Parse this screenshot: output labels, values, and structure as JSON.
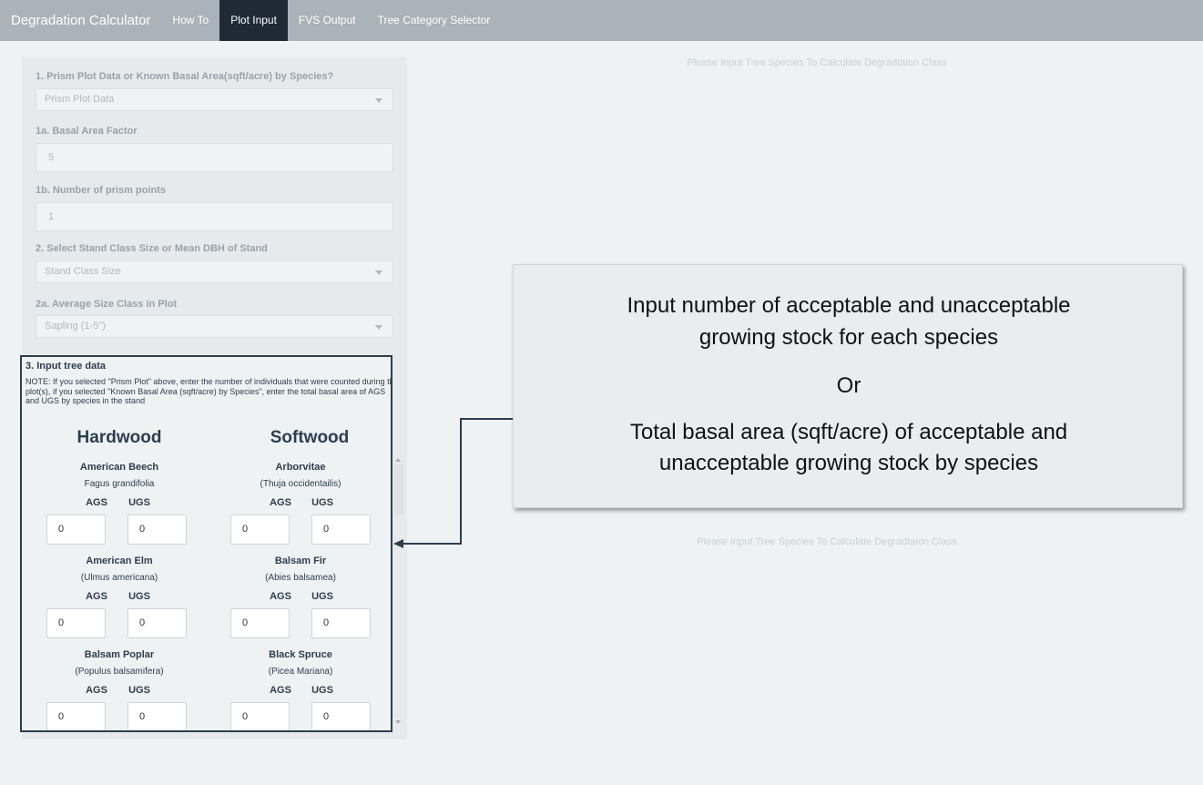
{
  "navbar": {
    "brand": "Degradation Calculator",
    "tabs": [
      {
        "label": "How To",
        "active": false
      },
      {
        "label": "Plot Input",
        "active": true
      },
      {
        "label": "FVS Output",
        "active": false
      },
      {
        "label": "Tree Category Selector",
        "active": false
      }
    ]
  },
  "form": {
    "q1_label": "1. Prism Plot Data or Known Basal Area(sqft/acre) by Species?",
    "q1_value": "Prism Plot Data",
    "q1a_label": "1a. Basal Area Factor",
    "q1a_value": "5",
    "q1b_label": "1b. Number of prism points",
    "q1b_value": "1",
    "q2_label": "2. Select Stand Class Size or Mean DBH of Stand",
    "q2_value": "Stand Class Size",
    "q2a_label": "2a. Average Size Class in Plot",
    "q2a_value": "Sapling (1-5\")"
  },
  "tree_data": {
    "title": "3. Input tree data",
    "note": "NOTE: If you selected \"Prism Plot\" above, enter the number of individuals that were counted during the plot(s), if you selected \"Known Basal Area (sqft/acre) by Species\", enter the total basal area of AGS and UGS by species in the stand",
    "hardwood_heading": "Hardwood",
    "softwood_heading": "Softwood",
    "ags_label": "AGS",
    "ugs_label": "UGS",
    "hardwood": [
      {
        "name": "American Beech",
        "sci": "Fagus grandifolia",
        "ags": "0",
        "ugs": "0"
      },
      {
        "name": "American Elm",
        "sci": "(Ulmus americana)",
        "ags": "0",
        "ugs": "0"
      },
      {
        "name": "Balsam Poplar",
        "sci": "(Populus balsamifera)",
        "ags": "0",
        "ugs": "0"
      }
    ],
    "softwood": [
      {
        "name": "Arborvitae",
        "sci": "(Thuja occidentailis)",
        "ags": "0",
        "ugs": "0"
      },
      {
        "name": "Balsam Fir",
        "sci": "(Abies balsamea)",
        "ags": "0",
        "ugs": "0"
      },
      {
        "name": "Black Spruce",
        "sci": "(Picea Mariana)",
        "ags": "0",
        "ugs": "0"
      }
    ]
  },
  "output": {
    "message_top": "Please Input Tree Species To Calculate Degradtaion Class",
    "message_bottom": "Please Input Tree Species To Calculate Degradtaion Class"
  },
  "callout": {
    "line1": "Input number of acceptable and unacceptable",
    "line2": "growing stock for each species",
    "line3": "Or",
    "line4": "Total basal area (sqft/acre) of acceptable and",
    "line5": "unacceptable growing stock by species"
  },
  "colors": {
    "navbar": "#aab3b9",
    "active_tab": "#1e2b37",
    "text_dark": "#2c3e50",
    "background": "#eef2f3"
  }
}
